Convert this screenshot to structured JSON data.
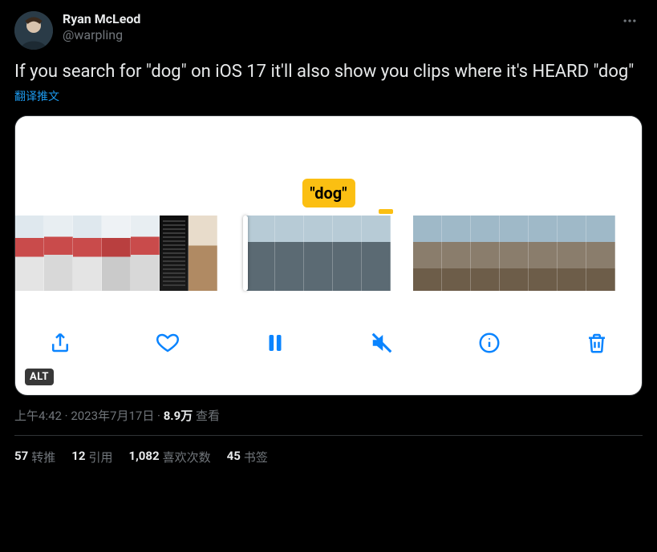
{
  "author": {
    "display_name": "Ryan McLeod",
    "handle": "@warpling"
  },
  "tweet_text": "If you search for \"dog\" on iOS 17 it'll also show you clips where it's HEARD \"dog\"",
  "translate_label": "翻译推文",
  "media": {
    "tooltip": "\"dog\"",
    "alt_badge": "ALT",
    "toolbar_icons": [
      "share-icon",
      "heart-icon",
      "pause-icon",
      "mute-icon",
      "info-icon",
      "trash-icon"
    ]
  },
  "meta": {
    "time": "上午4:42",
    "date": "2023年7月17日",
    "views_number": "8.9万",
    "views_label": "查看",
    "separator": " · "
  },
  "stats": {
    "retweets": {
      "num": "57",
      "label": "转推"
    },
    "quotes": {
      "num": "12",
      "label": "引用"
    },
    "likes": {
      "num": "1,082",
      "label": "喜欢次数"
    },
    "bookmarks": {
      "num": "45",
      "label": "书签"
    }
  }
}
